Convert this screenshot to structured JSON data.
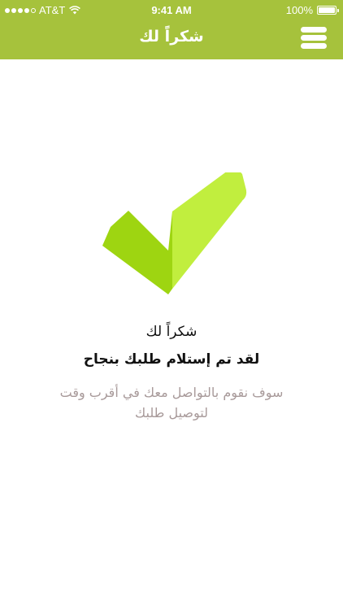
{
  "status_bar": {
    "carrier": "AT&T",
    "time": "9:41 AM",
    "battery_percent": "100%"
  },
  "header": {
    "title": "شكراً لك",
    "menu_icon": "hamburger-menu-icon"
  },
  "success": {
    "icon": "checkmark-icon",
    "thanks_title": "شكراً لك",
    "message": "لقد تم إستلام طلبك بنجاح",
    "contact_message": "سوف نقوم بالتواصل معك في أقرب وقت لتوصيل طلبك"
  },
  "colors": {
    "header_background": "#a6c23c",
    "check_dark": "#9ed511",
    "check_light": "#c1ee3e",
    "secondary_text": "#a89a9a"
  }
}
